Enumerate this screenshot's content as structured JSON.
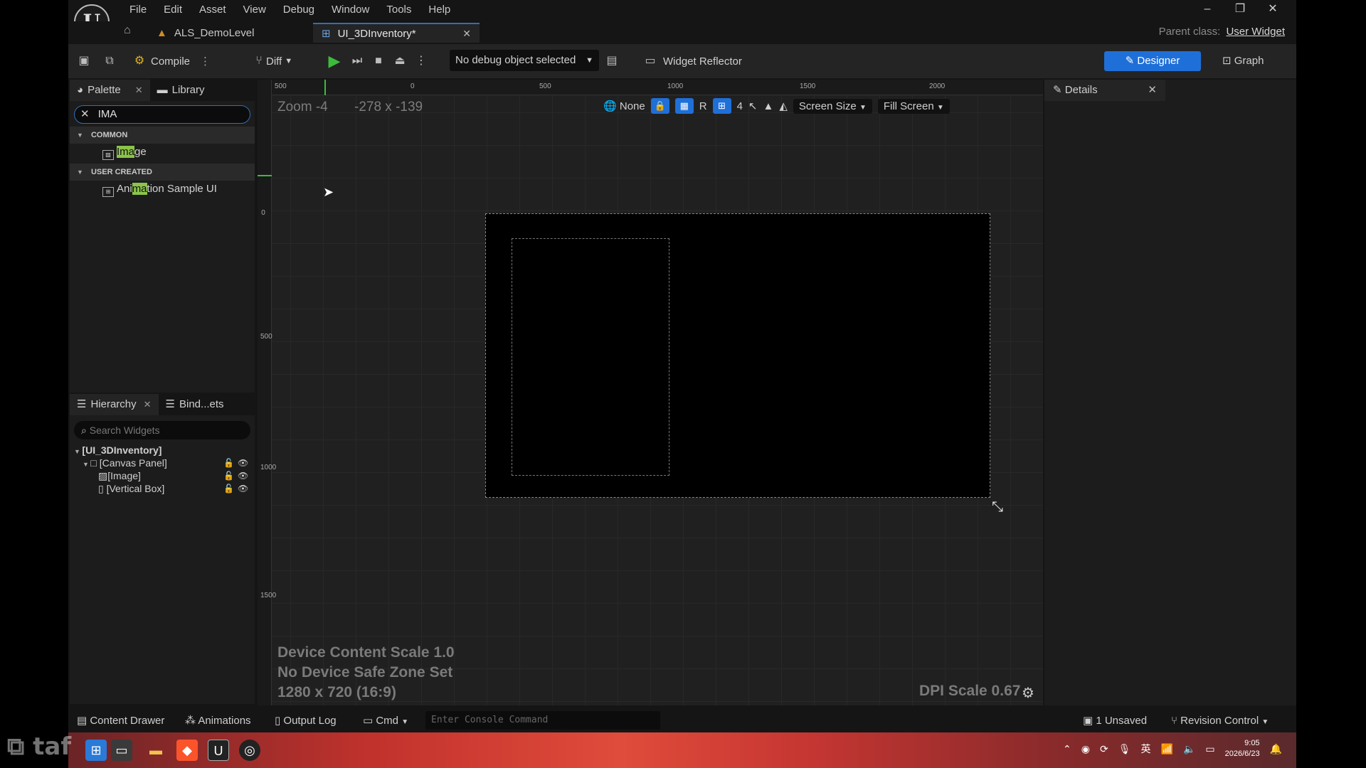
{
  "app": {
    "menu": [
      "File",
      "Edit",
      "Asset",
      "View",
      "Debug",
      "Window",
      "Tools",
      "Help"
    ],
    "tabs": [
      {
        "label": "ALS_DemoLevel"
      },
      {
        "label": "UI_3DInventory*"
      }
    ],
    "parent_class_label": "Parent class:",
    "parent_class_value": "User Widget"
  },
  "toolbar": {
    "compile_label": "Compile",
    "diff_label": "Diff",
    "debug_object": "No debug object selected",
    "widget_reflector": "Widget Reflector",
    "designer_label": "Designer",
    "graph_label": "Graph"
  },
  "palette": {
    "tab_palette": "Palette",
    "tab_library": "Library",
    "search_value": "IMA",
    "categories": [
      {
        "name": "COMMON",
        "items": [
          {
            "pre": "",
            "hl": "Ima",
            "post": "ge"
          }
        ]
      },
      {
        "name": "USER CREATED",
        "items": [
          {
            "pre": "Ani",
            "hl": "ma",
            "post": "tion Sample UI"
          }
        ]
      }
    ]
  },
  "hierarchy": {
    "tab_hierarchy": "Hierarchy",
    "tab_bind": "Bind...ets",
    "search_placeholder": "Search Widgets",
    "items": [
      "[UI_3DInventory]",
      "[Canvas Panel]",
      "[Image]",
      "[Vertical Box]"
    ]
  },
  "viewport": {
    "zoom": "Zoom -4",
    "coords": "-278 x -139",
    "ruler_top": [
      "500",
      "0",
      "500",
      "1000",
      "1500",
      "2000"
    ],
    "ruler_left": [
      "0",
      "500",
      "1000",
      "1500"
    ],
    "localization": "None",
    "grid_count": "4",
    "r_label": "R",
    "screen_size": "Screen Size",
    "fill_screen": "Fill Screen",
    "device_content_scale": "Device Content Scale 1.0",
    "safe_zone": "No Device Safe Zone Set",
    "resolution": "1280 x 720 (16:9)",
    "dpi_scale": "DPI Scale 0.67"
  },
  "details": {
    "tab_label": "Details"
  },
  "statusbar": {
    "content_drawer": "Content Drawer",
    "animations": "Animations",
    "output_log": "Output Log",
    "cmd": "Cmd",
    "console_placeholder": "Enter Console Command",
    "unsaved": "1 Unsaved",
    "revision_control": "Revision Control"
  },
  "taskbar": {
    "watermark": "taf",
    "time": "9:05",
    "date": "2026/6/23",
    "ime": "英"
  }
}
